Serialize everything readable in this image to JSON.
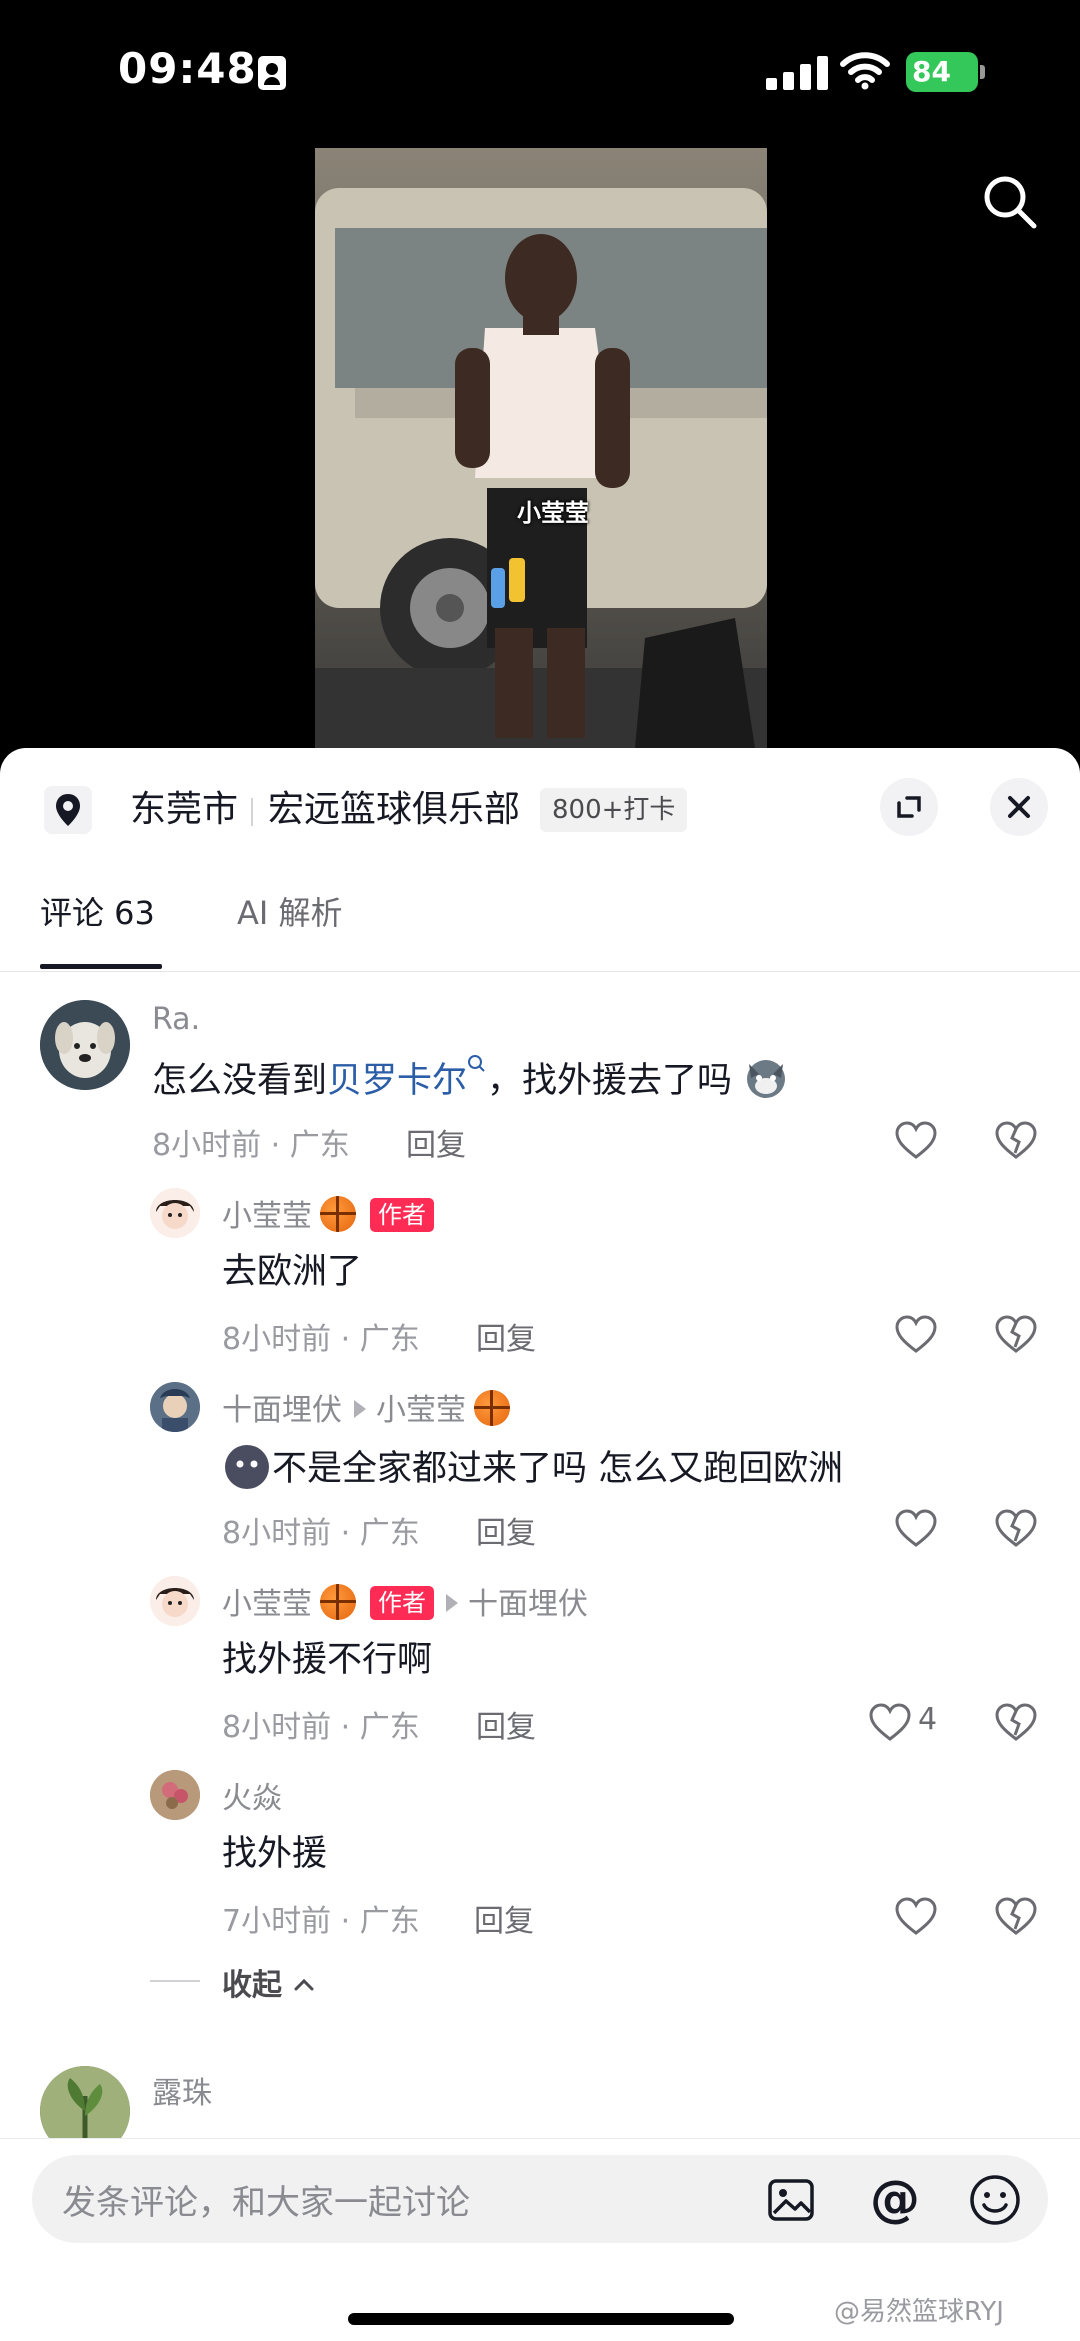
{
  "status_bar": {
    "time": "09:48",
    "battery": "84"
  },
  "video": {
    "watermark": "小莹莹"
  },
  "location": {
    "city": "东莞市",
    "place": "宏远篮球俱乐部",
    "checkins": "800+打卡"
  },
  "tabs": {
    "comments": "评论 63",
    "ai": "AI 解析"
  },
  "comments": [
    {
      "user": "Ra.",
      "text_before": "怎么没看到",
      "mention": "贝罗卡尔",
      "text_after": "，找外援去了吗",
      "time_location": "8小时前 · 广东",
      "reply": "回复"
    }
  ],
  "replies": [
    {
      "user": "小莹莹",
      "badge": "作者",
      "text": "去欧洲了",
      "time_location": "8小时前 · 广东",
      "reply": "回复"
    },
    {
      "user": "十面埋伏",
      "reply_to": "小莹莹",
      "text": "不是全家都过来了吗 怎么又跑回欧洲",
      "time_location": "8小时前 · 广东",
      "reply": "回复"
    },
    {
      "user": "小莹莹",
      "badge": "作者",
      "reply_to": "十面埋伏",
      "text": "找外援不行啊",
      "time_location": "8小时前 · 广东",
      "reply": "回复",
      "likes": "4"
    },
    {
      "user": "火焱",
      "text": "找外援",
      "time_location": "7小时前 · 广东",
      "reply": "回复"
    }
  ],
  "collapse_label": "收起",
  "next_comment": {
    "user": "露珠"
  },
  "input": {
    "placeholder": "发条评论，和大家一起讨论"
  },
  "watermark": "@易然篮球RYJ",
  "colors": {
    "accent": "#fe2c55",
    "mention": "#2c5ea8",
    "battery": "#34c759"
  }
}
